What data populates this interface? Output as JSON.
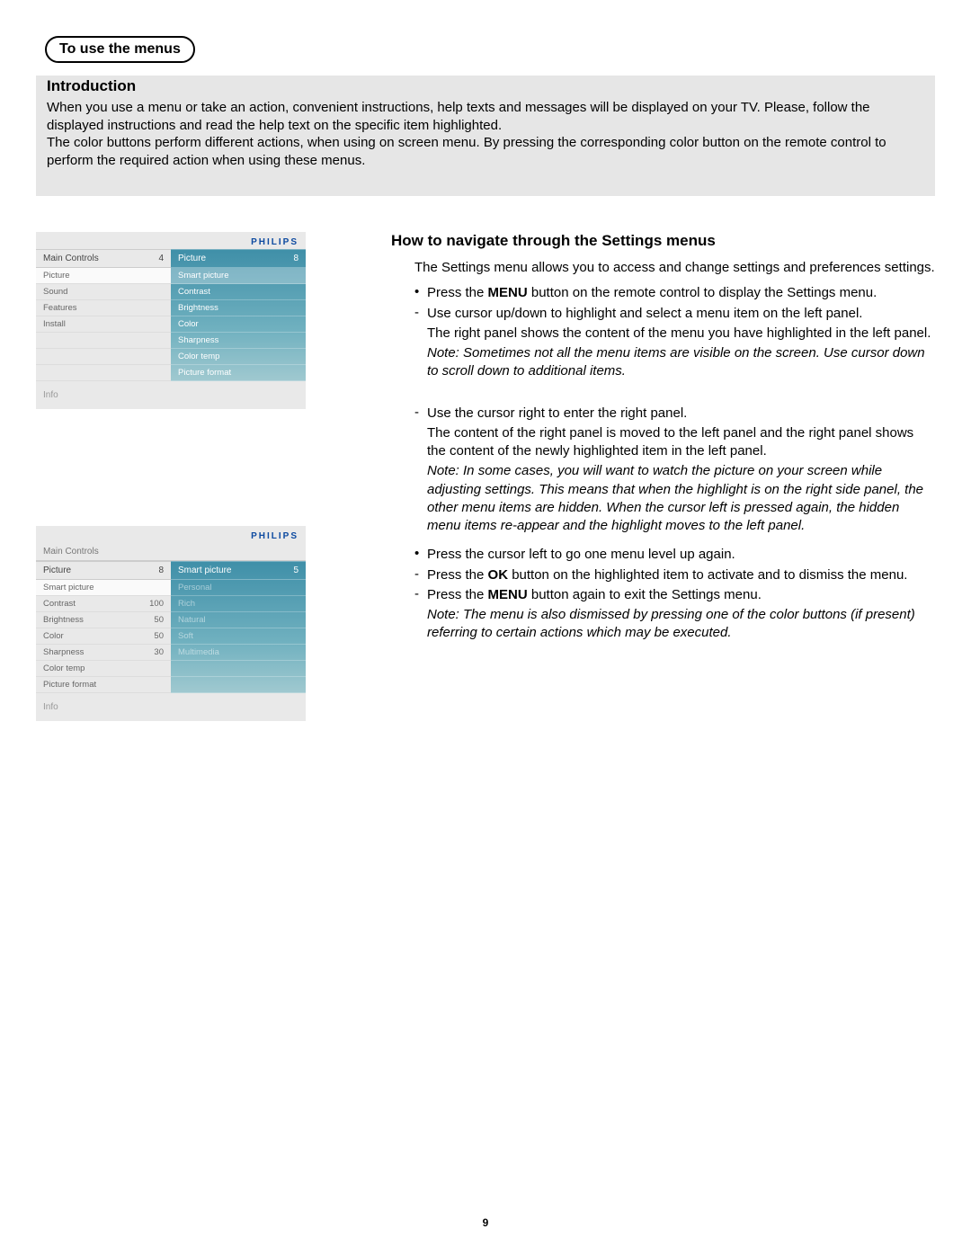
{
  "page_number": "9",
  "title_badge": "To use the menus",
  "intro": {
    "heading": "Introduction",
    "p1": "When you use a menu or take an action, convenient instructions, help texts and messages will be displayed on your TV. Please, follow the displayed instructions and read the help text on the specific item highlighted.",
    "p2": "The color buttons perform different actions, when using on screen menu. By pressing the corresponding color button on the remote control to perform the required action when using these menus."
  },
  "nav": {
    "heading": "How to navigate through the Settings menus",
    "lead": "The Settings menu allows you to access and change settings and preferences settings.",
    "b1_pre": "Press the ",
    "b1_bold": "MENU",
    "b1_post": " button on the remote control to display the Settings menu.",
    "d1": "Use cursor up/down to highlight and select a menu item on the left panel.",
    "f1": "The right panel shows the content of the menu you have highlighted in the left panel.",
    "note1": "Note: Sometimes not all the menu items are visible on the screen. Use cursor down to scroll down to additional items.",
    "d2": "Use the cursor right to enter the right panel.",
    "f2": "The content of the right panel is moved to the left panel and the right panel shows the content of the newly highlighted item in the left panel.",
    "note2": "Note: In some cases, you will want to watch the picture on your screen while adjusting settings. This means that when the highlight is on the right side panel, the other menu items are hidden. When the cursor left is pressed again, the hidden menu items re-appear and the highlight moves to the left panel.",
    "b2": "Press the cursor left to go one menu level up again.",
    "d3_pre": "Press the ",
    "d3_bold": "OK",
    "d3_post": " button on the highlighted item to activate and to dismiss the menu.",
    "d4_pre": "Press the ",
    "d4_bold": "MENU",
    "d4_post": " button again to exit the Settings menu.",
    "note3": "Note: The menu is also dismissed by pressing one of the color buttons (if present) referring to certain actions which may be executed."
  },
  "brand": "PHILIPS",
  "info_label": "Info",
  "shot1": {
    "left_title": "Main Controls",
    "left_count": "4",
    "right_title": "Picture",
    "right_count": "8",
    "left_items": [
      "Picture",
      "Sound",
      "Features",
      "Install"
    ],
    "right_items": [
      "Smart picture",
      "Contrast",
      "Brightness",
      "Color",
      "Sharpness",
      "Color temp",
      "Picture format"
    ]
  },
  "shot2": {
    "breadcrumb": "Main Controls",
    "left_title": "Picture",
    "left_count": "8",
    "right_title": "Smart picture",
    "right_count": "5",
    "left_items": [
      {
        "label": "Smart picture",
        "val": ""
      },
      {
        "label": "Contrast",
        "val": "100"
      },
      {
        "label": "Brightness",
        "val": "50"
      },
      {
        "label": "Color",
        "val": "50"
      },
      {
        "label": "Sharpness",
        "val": "30"
      },
      {
        "label": "Color temp",
        "val": ""
      },
      {
        "label": "Picture format",
        "val": ""
      }
    ],
    "right_items": [
      "Personal",
      "Rich",
      "Natural",
      "Soft",
      "Multimedia"
    ]
  }
}
